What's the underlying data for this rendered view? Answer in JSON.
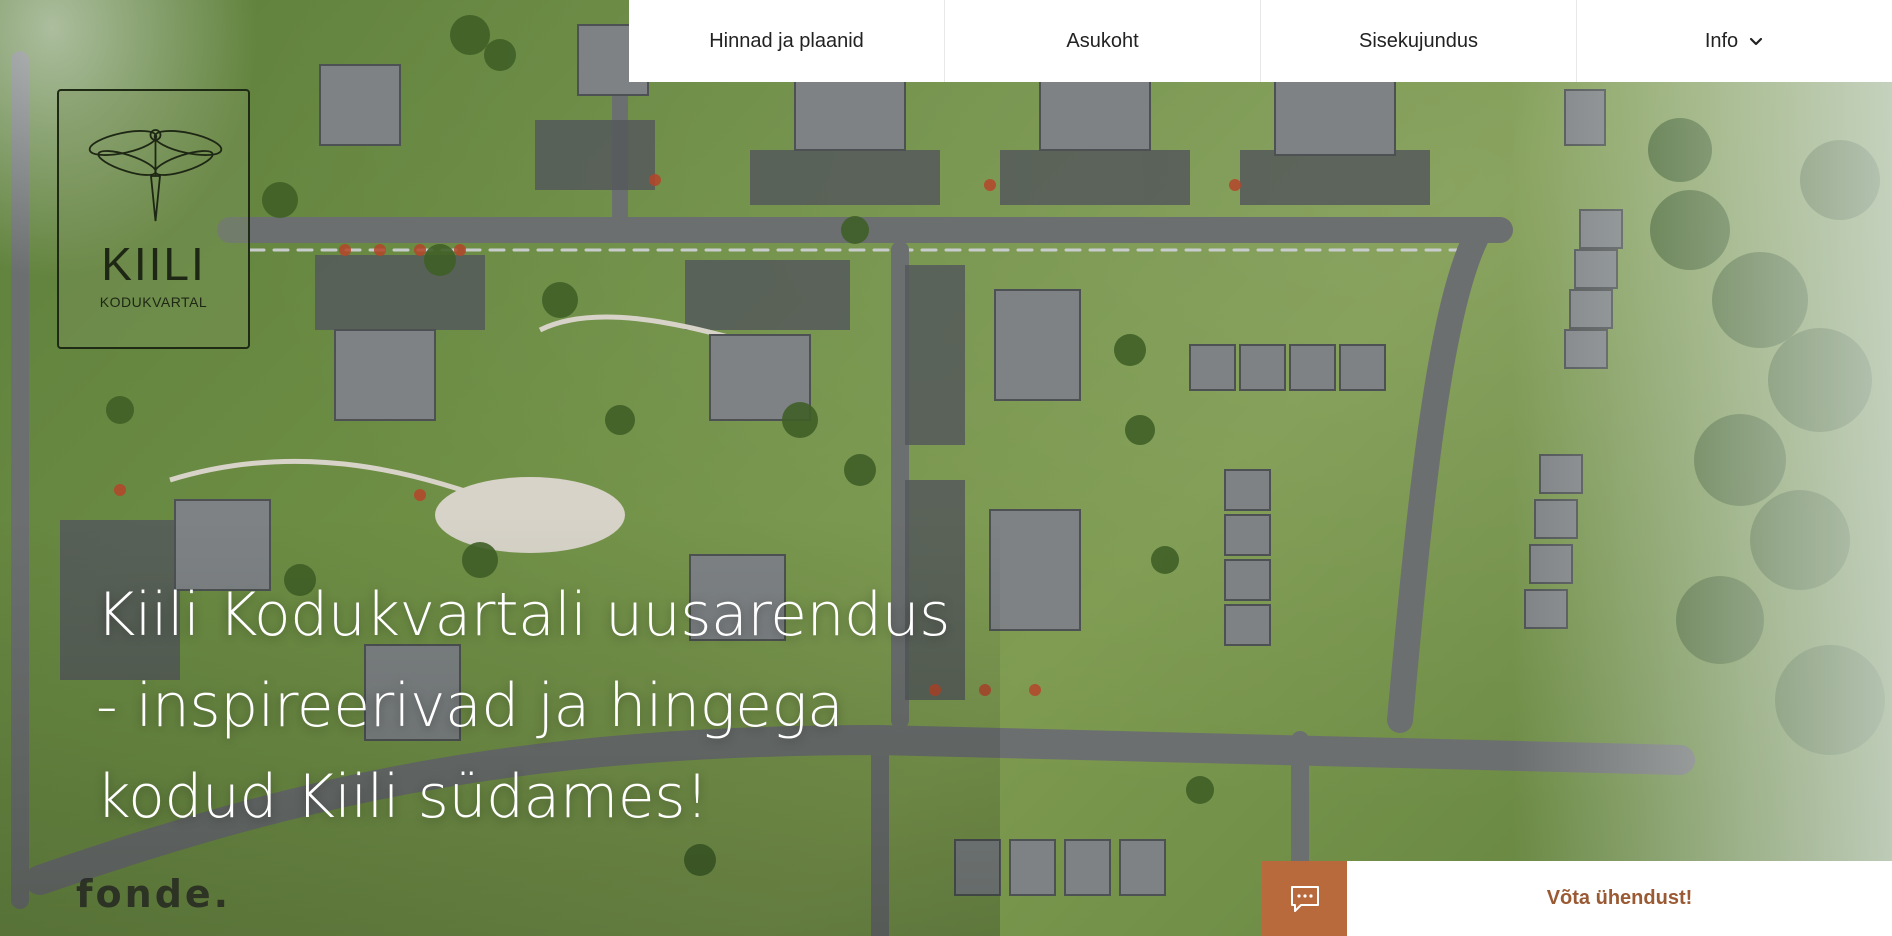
{
  "nav": {
    "items": [
      {
        "label": "Hinnad ja plaanid"
      },
      {
        "label": "Asukoht"
      },
      {
        "label": "Sisekujundus"
      },
      {
        "label": "Info",
        "icon": "chevron-down-icon"
      }
    ]
  },
  "logo": {
    "word": "KIILI",
    "subtitle": "KODUKVARTAL",
    "icon": "dragonfly-icon"
  },
  "hero": {
    "headline_lines": [
      "Kiili Kodukvartali uusarendus",
      "- inspireerivad ja hingega",
      "kodud Kiili südames!"
    ]
  },
  "developer": {
    "name": "fonde."
  },
  "contact": {
    "label": "Võta ühendust!",
    "icon": "chat-icon"
  },
  "colors": {
    "accent": "#b86a3d",
    "contact_text": "#9a5a34",
    "nav_bg": "#ffffff"
  }
}
